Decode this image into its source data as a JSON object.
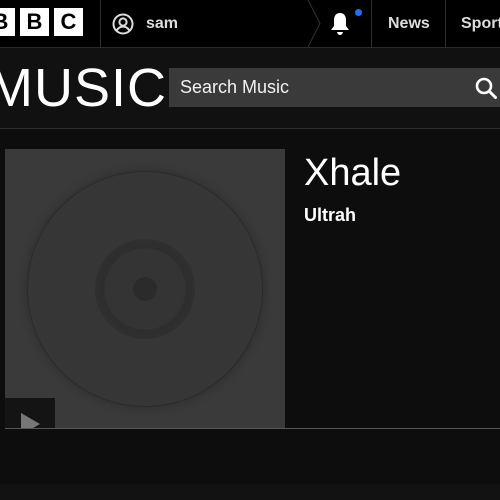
{
  "topbar": {
    "brand_letters": [
      "B",
      "B",
      "C"
    ],
    "account_name": "sam",
    "nav_links": [
      "News",
      "Sport"
    ],
    "notification_dot_color": "#1f6fff"
  },
  "music": {
    "title": "MUSIC",
    "search_placeholder": "Search Music"
  },
  "track": {
    "title": "Xhale",
    "artist": "Ultrah"
  },
  "icons": {
    "account": "user-circle-icon",
    "notifications": "bell-icon",
    "search": "search-icon",
    "play": "play-icon",
    "artwork": "vinyl-record-icon"
  },
  "colors": {
    "background": "#0b0b0b",
    "topbar": "#000000",
    "search_bg": "#3a3a3a",
    "artwork_bg": "#3a3a3a",
    "text": "#ffffff"
  }
}
